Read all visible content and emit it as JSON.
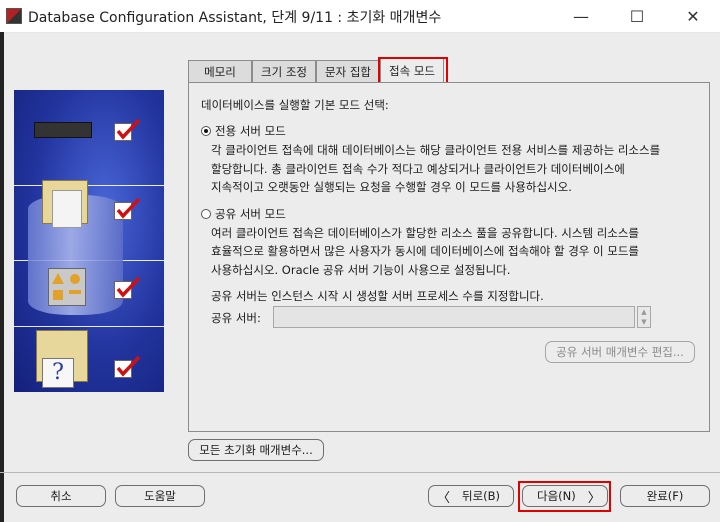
{
  "window": {
    "title": "Database Configuration Assistant, 단계 9/11 : 초기화 매개변수",
    "minimize_glyph": "—",
    "maximize_glyph": "☐",
    "close_glyph": "✕"
  },
  "tabs": [
    {
      "label": "메모리",
      "active": false
    },
    {
      "label": "크기 조정",
      "active": false
    },
    {
      "label": "문자 집합",
      "active": false
    },
    {
      "label": "접속 모드",
      "active": true
    }
  ],
  "panel": {
    "heading": "데이터베이스를 실행할 기본 모드 선택:",
    "dedicated": {
      "label": "전용 서버 모드",
      "selected": true,
      "description": [
        "각 클라이언트 접속에 대해 데이터베이스는 해당 클라이언트 전용 서비스를 제공하는 리소스를",
        "할당합니다. 총 클라이언트 접속 수가 적다고 예상되거나 클라이언트가 데이터베이스에",
        "지속적이고 오랫동안 실행되는 요청을 수행할 경우 이 모드를 사용하십시오."
      ]
    },
    "shared": {
      "label": "공유 서버 모드",
      "selected": false,
      "description": [
        "여러 클라이언트 접속은 데이터베이스가 할당한 리소스 풀을 공유합니다. 시스템 리소스를",
        "효율적으로 활용하면서 많은 사용자가 동시에 데이터베이스에 접속해야 할 경우 이 모드를",
        "사용하십시오. Oracle 공유 서버 기능이 사용으로 설정됩니다."
      ]
    },
    "shared_servers_hint": "공유 서버는 인스턴스 시작 시 생성할 서버 프로세스 수를 지정합니다.",
    "shared_servers_label": "공유 서버:",
    "shared_servers_value": "",
    "edit_shared_params_button": "공유 서버 매개변수 편집..."
  },
  "all_init_params_button": "모든 초기화 매개변수...",
  "footer": {
    "cancel": "취소",
    "help": "도움말",
    "back": "뒤로(B)",
    "next": "다음(N)",
    "finish": "완료(F)"
  },
  "colors": {
    "highlight": "#e00000",
    "wizard_bg": "#22349e"
  }
}
